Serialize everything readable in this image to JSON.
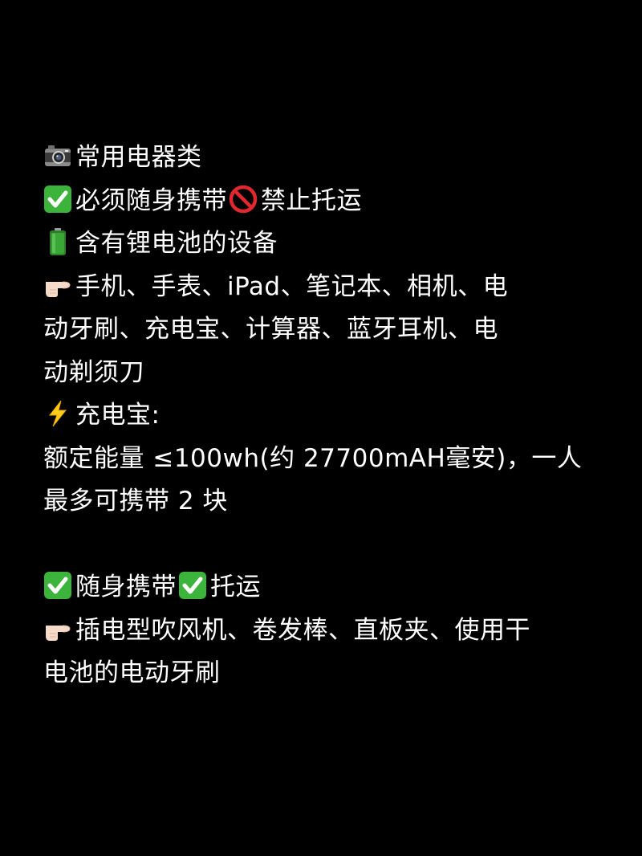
{
  "icons": {
    "camera": "camera-icon",
    "check": "check-mark-button-icon",
    "prohibited": "prohibited-icon",
    "battery": "battery-icon",
    "pointing": "backhand-index-pointing-right-icon",
    "lightning": "high-voltage-icon"
  },
  "colors": {
    "background": "#000000",
    "text": "#ffffff",
    "check_green": "#3cb43c",
    "prohibited_red": "#e0282e",
    "battery_green": "#3aa635",
    "lightning_yellow": "#ffcc1e"
  },
  "sections": {
    "appliances_title": "常用电器类",
    "carry_on": "必须随身携带",
    "no_checkin": "禁止托运",
    "lithium_devices": "含有锂电池的设备",
    "devices_list_1": "手机、手表、iPad、笔记本、相机、电",
    "devices_list_2": "动牙刷、充电宝、计算器、蓝牙耳机、电",
    "devices_list_3": "动剃须刀",
    "power_bank_title": "充电宝:",
    "power_bank_rule_1": "额定能量 ≤100wh(约 27700mAH毫安)，一人",
    "power_bank_rule_2": "最多可携带 2 块",
    "both_carry": "随身携带",
    "both_check": "托运",
    "both_list_1": "插电型吹风机、卷发棒、直板夹、使用干",
    "both_list_2": "电池的电动牙刷"
  }
}
